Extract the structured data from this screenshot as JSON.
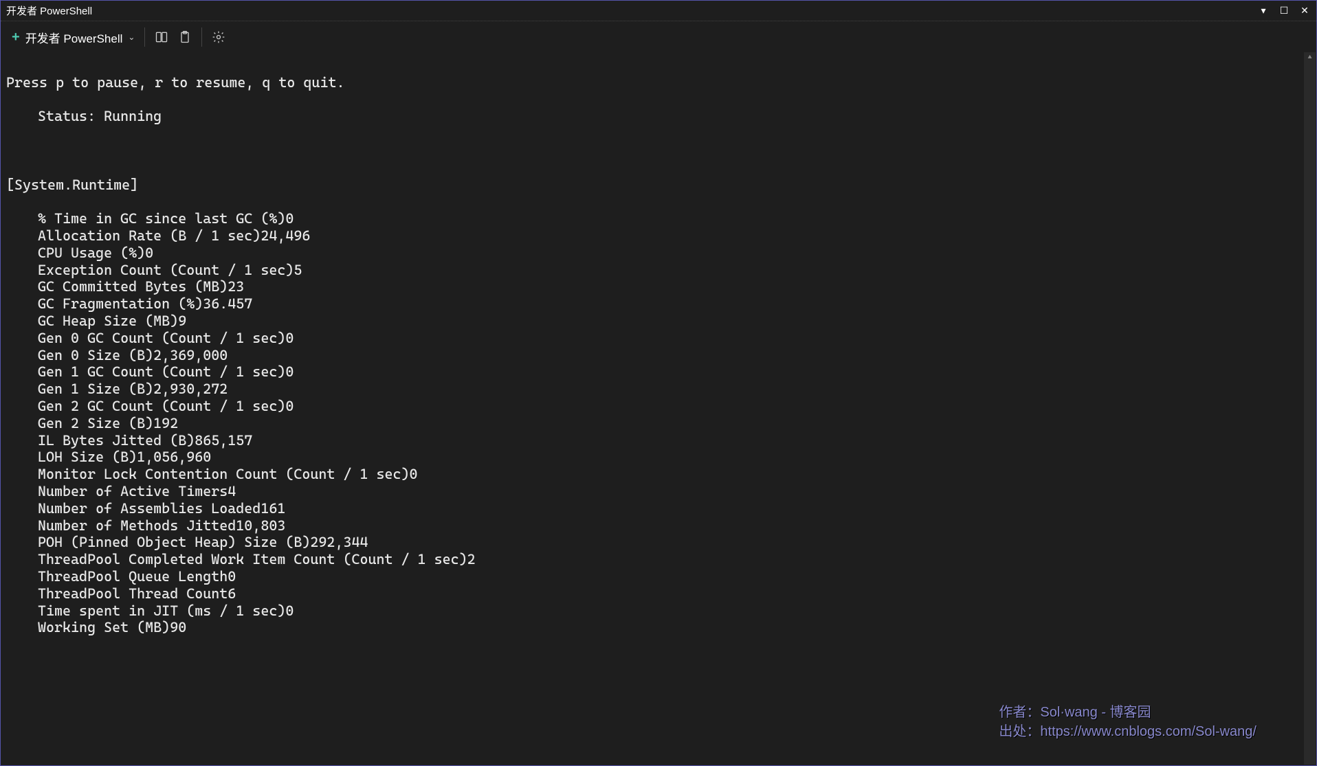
{
  "window": {
    "title": "开发者 PowerShell"
  },
  "toolbar": {
    "tab_label": "开发者 PowerShell"
  },
  "terminal": {
    "help_line": "Press p to pause, r to resume, q to quit.",
    "status_label": "Status:",
    "status_value": "Running",
    "section_header": "[System.Runtime]",
    "metrics": [
      {
        "label": "% Time in GC since last GC (%)",
        "value": "0"
      },
      {
        "label": "Allocation Rate (B / 1 sec)",
        "value": "24,496"
      },
      {
        "label": "CPU Usage (%)",
        "value": "0"
      },
      {
        "label": "Exception Count (Count / 1 sec)",
        "value": "5"
      },
      {
        "label": "GC Committed Bytes (MB)",
        "value": "23"
      },
      {
        "label": "GC Fragmentation (%)",
        "value": "36.457"
      },
      {
        "label": "GC Heap Size (MB)",
        "value": "9"
      },
      {
        "label": "Gen 0 GC Count (Count / 1 sec)",
        "value": "0"
      },
      {
        "label": "Gen 0 Size (B)",
        "value": "2,369,000"
      },
      {
        "label": "Gen 1 GC Count (Count / 1 sec)",
        "value": "0"
      },
      {
        "label": "Gen 1 Size (B)",
        "value": "2,930,272"
      },
      {
        "label": "Gen 2 GC Count (Count / 1 sec)",
        "value": "0"
      },
      {
        "label": "Gen 2 Size (B)",
        "value": "192"
      },
      {
        "label": "IL Bytes Jitted (B)",
        "value": "865,157"
      },
      {
        "label": "LOH Size (B)",
        "value": "1,056,960"
      },
      {
        "label": "Monitor Lock Contention Count (Count / 1 sec)",
        "value": "0"
      },
      {
        "label": "Number of Active Timers",
        "value": "4"
      },
      {
        "label": "Number of Assemblies Loaded",
        "value": "161"
      },
      {
        "label": "Number of Methods Jitted",
        "value": "10,803"
      },
      {
        "label": "POH (Pinned Object Heap) Size (B)",
        "value": "292,344"
      },
      {
        "label": "ThreadPool Completed Work Item Count (Count / 1 sec)",
        "value": "2"
      },
      {
        "label": "ThreadPool Queue Length",
        "value": "0"
      },
      {
        "label": "ThreadPool Thread Count",
        "value": "6"
      },
      {
        "label": "Time spent in JIT (ms / 1 sec)",
        "value": "0"
      },
      {
        "label": "Working Set (MB)",
        "value": "90"
      }
    ]
  },
  "watermark": {
    "line1": "作者：Sol·wang - 博客园",
    "line2": "出处：https://www.cnblogs.com/Sol-wang/"
  }
}
